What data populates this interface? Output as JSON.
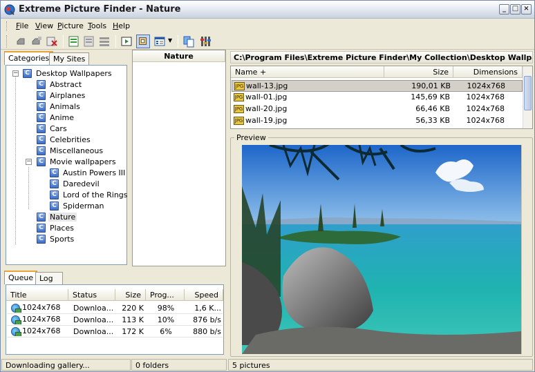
{
  "window": {
    "title": "Extreme Picture Finder - Nature"
  },
  "menu": {
    "items": [
      "File",
      "View",
      "Picture",
      "Tools",
      "Help"
    ],
    "underline": [
      "F",
      "V",
      "P",
      "T",
      "H"
    ]
  },
  "left_tabs": [
    "Categories",
    "My Sites"
  ],
  "tree": {
    "root": "Desktop Wallpapers",
    "items": [
      "Abstract",
      "Airplanes",
      "Animals",
      "Anime",
      "Cars",
      "Celebrities",
      "Miscellaneous",
      "Movie wallpapers",
      "Austin Powers III",
      "Daredevil",
      "Lord of the Rings",
      "Spiderman",
      "Nature",
      "Places",
      "Sports"
    ],
    "folder_glyph": "C"
  },
  "middle_panel": {
    "header": "Nature"
  },
  "path": "C:\\Program Files\\Extreme Picture Finder\\My Collection\\Desktop Wallpapers\\",
  "files": {
    "columns": [
      "Name +",
      "Size",
      "Dimensions"
    ],
    "rows": [
      {
        "name": "wall-13.jpg",
        "size": "190,01 KB",
        "dims": "1024x768"
      },
      {
        "name": "wall-01.jpg",
        "size": "145,69 KB",
        "dims": "1024x768"
      },
      {
        "name": "wall-20.jpg",
        "size": "66,46 KB",
        "dims": "1024x768"
      },
      {
        "name": "wall-19.jpg",
        "size": "56,33 KB",
        "dims": "1024x768"
      }
    ],
    "icon_text": "JPG"
  },
  "preview": {
    "label": "Preview"
  },
  "bottom_tabs": [
    "Queue",
    "Log"
  ],
  "queue": {
    "columns": [
      "Title",
      "Status",
      "Size",
      "Prog...",
      "Speed"
    ],
    "rows": [
      {
        "title": "1024x768",
        "status": "Downloa...",
        "size": "220 K",
        "progress": "98%",
        "speed": "1,6 K..."
      },
      {
        "title": "1024x768",
        "status": "Downloa...",
        "size": "113 K",
        "progress": "10%",
        "speed": "876 b/s"
      },
      {
        "title": "1024x768",
        "status": "Downloa...",
        "size": "172 K",
        "progress": "6%",
        "speed": "880 b/s"
      }
    ]
  },
  "status": {
    "left": "Downloading gallery...",
    "middle": "0 folders",
    "right": "5 pictures"
  },
  "colors": {
    "selection_border": "#4a6ea8",
    "tab_accent": "#e8a33a",
    "panel_border": "#7f9db9"
  }
}
